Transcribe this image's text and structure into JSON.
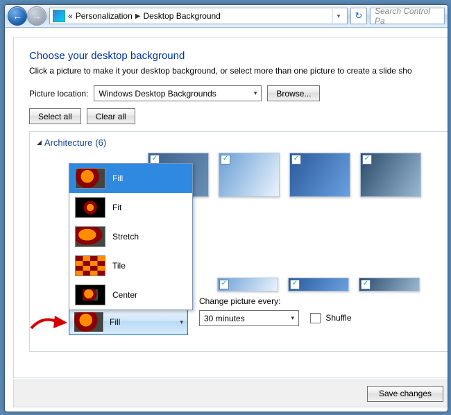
{
  "breadcrumb": {
    "prefix": "«",
    "parent": "Personalization",
    "current": "Desktop Background"
  },
  "search": {
    "placeholder": "Search Control Pa"
  },
  "page": {
    "title": "Choose your desktop background",
    "subtitle": "Click a picture to make it your desktop background, or select more than one picture to create a slide sho"
  },
  "location": {
    "label": "Picture location:",
    "value": "Windows Desktop Backgrounds",
    "browse": "Browse..."
  },
  "selection": {
    "select_all": "Select all",
    "clear_all": "Clear all"
  },
  "group": {
    "name": "Architecture",
    "count": "(6)"
  },
  "position": {
    "current": "Fill",
    "options": [
      "Fill",
      "Fit",
      "Stretch",
      "Tile",
      "Center"
    ]
  },
  "change": {
    "label": "Change picture every:",
    "value": "30 minutes",
    "shuffle_label": "Shuffle",
    "shuffle_checked": false
  },
  "footer": {
    "save": "Save changes"
  }
}
